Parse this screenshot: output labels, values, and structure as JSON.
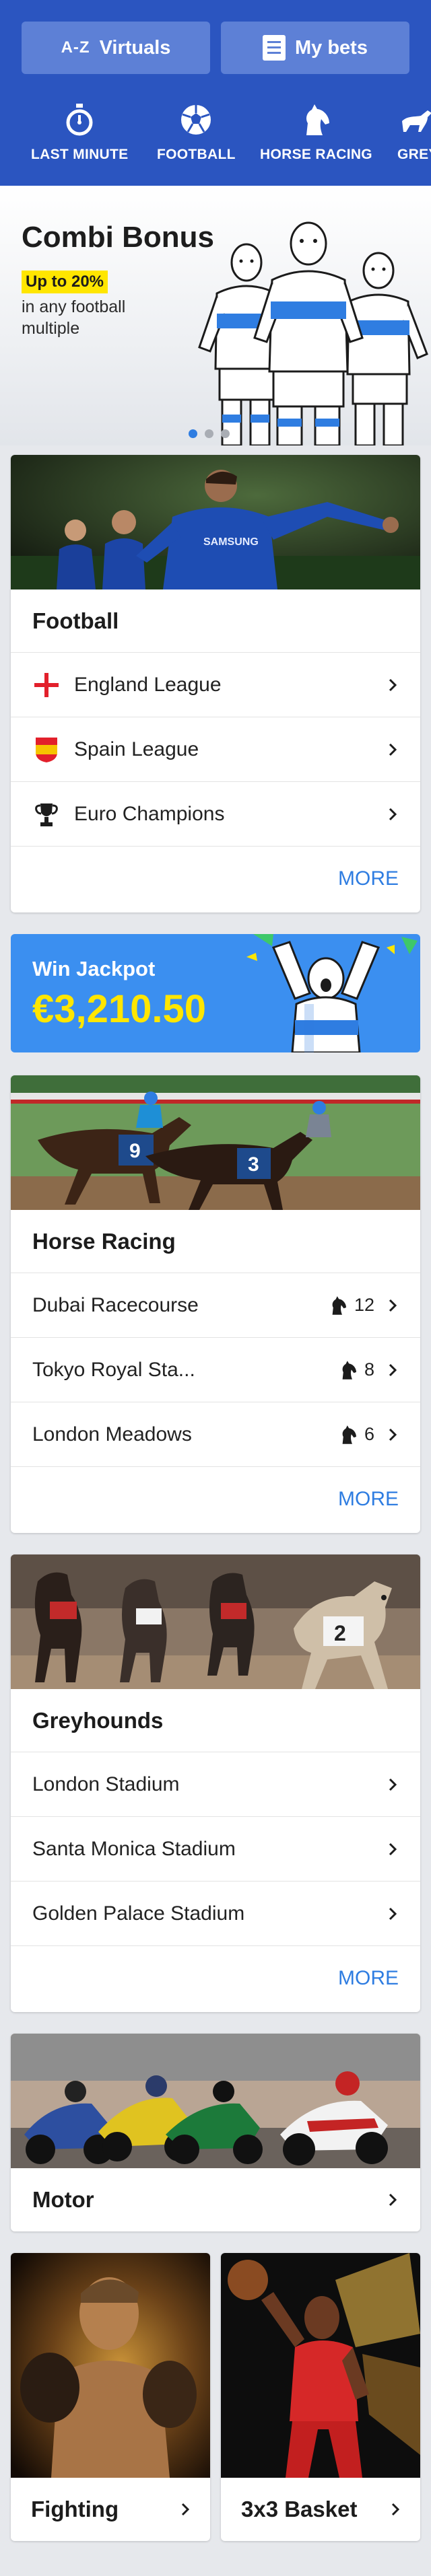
{
  "header": {
    "az_button": {
      "glyph": "A-Z",
      "label": "Virtuals"
    },
    "bets_button": {
      "label": "My bets"
    },
    "nav": [
      {
        "label": "LAST MINUTE",
        "icon": "stopwatch-icon"
      },
      {
        "label": "FOOTBALL",
        "icon": "football-icon"
      },
      {
        "label": "HORSE RACING",
        "icon": "horse-icon"
      },
      {
        "label": "GREY",
        "icon": "greyhound-icon"
      }
    ]
  },
  "promo": {
    "title": "Combi Bonus",
    "chip": "Up to 20%",
    "subtitle": "in any football multiple",
    "slides": 3,
    "active_slide": 0
  },
  "football": {
    "title": "Football",
    "rows": [
      {
        "label": "England League",
        "flag": "england-flag-icon"
      },
      {
        "label": "Spain League",
        "flag": "spain-flag-icon"
      },
      {
        "label": "Euro Champions",
        "flag": "trophy-icon"
      }
    ],
    "more": "MORE"
  },
  "jackpot": {
    "label": "Win Jackpot",
    "value": "€3,210.50"
  },
  "horse_racing": {
    "title": "Horse Racing",
    "rows": [
      {
        "label": "Dubai Racecourse",
        "count": "12"
      },
      {
        "label": "Tokyo Royal Sta...",
        "count": "8"
      },
      {
        "label": "London Meadows",
        "count": "6"
      }
    ],
    "more": "MORE"
  },
  "greyhounds": {
    "title": "Greyhounds",
    "rows": [
      {
        "label": "London Stadium"
      },
      {
        "label": "Santa Monica Stadium"
      },
      {
        "label": "Golden Palace Stadium"
      }
    ],
    "more": "MORE"
  },
  "motor": {
    "title": "Motor"
  },
  "fighting": {
    "title": "Fighting"
  },
  "basket": {
    "title": "3x3 Basket"
  },
  "colors": {
    "header_bg": "#2b55c0",
    "header_button": "#5d80d6",
    "accent_blue": "#2f7de1",
    "jackpot_bg": "#3b8ff0",
    "highlight_yellow": "#ffe600"
  }
}
